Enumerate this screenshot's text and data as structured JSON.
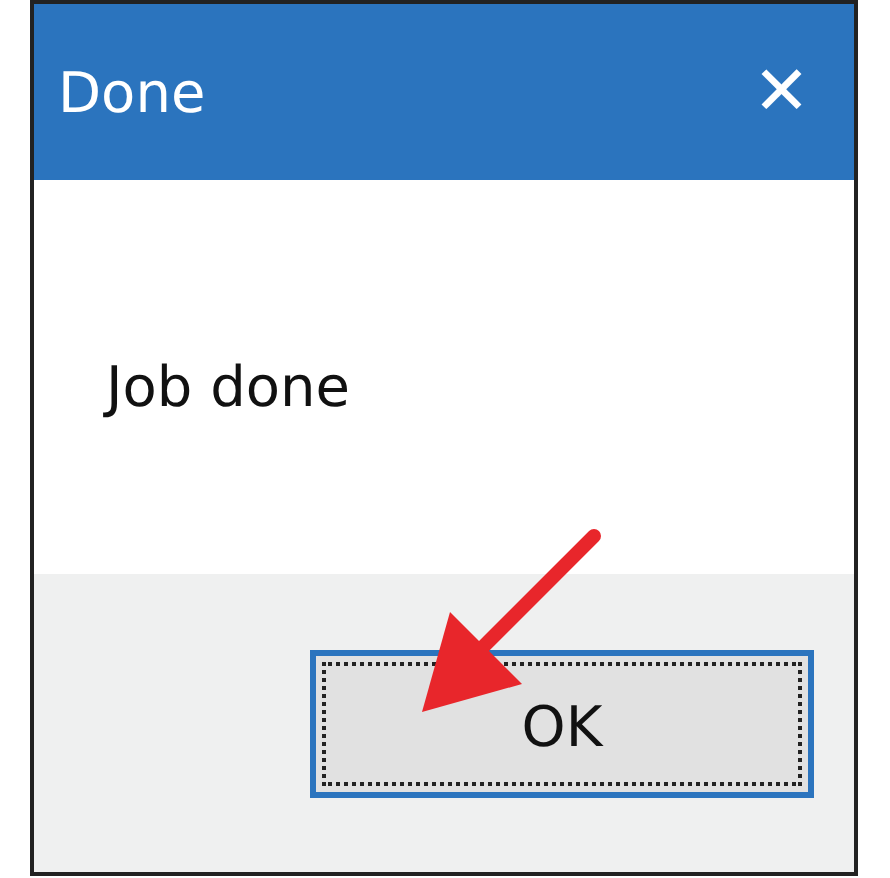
{
  "window": {
    "title": "Done",
    "close": "✕"
  },
  "message": "Job done",
  "buttons": [
    {
      "label": "OK",
      "focused": true
    }
  ]
}
